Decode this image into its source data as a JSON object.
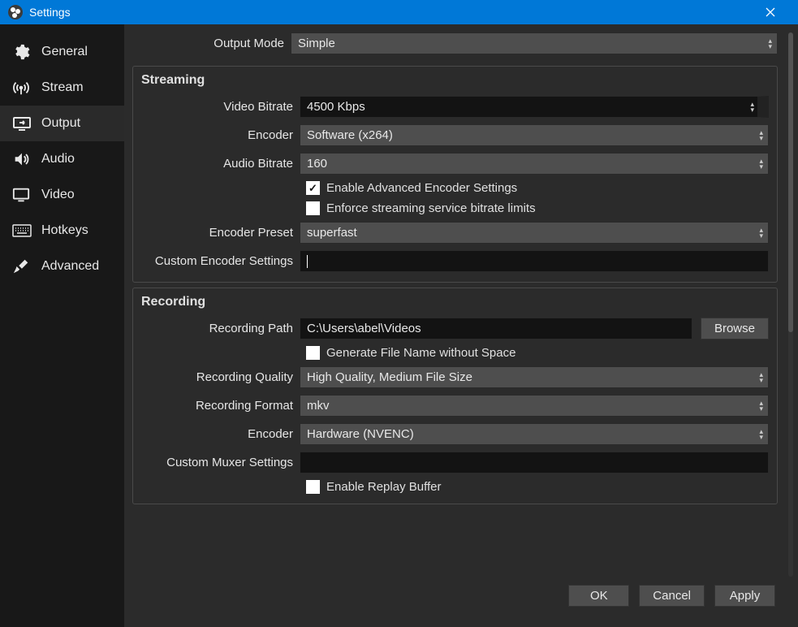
{
  "title": "Settings",
  "sidebar": {
    "items": [
      {
        "label": "General"
      },
      {
        "label": "Stream"
      },
      {
        "label": "Output"
      },
      {
        "label": "Audio"
      },
      {
        "label": "Video"
      },
      {
        "label": "Hotkeys"
      },
      {
        "label": "Advanced"
      }
    ]
  },
  "output_mode": {
    "label": "Output Mode",
    "value": "Simple"
  },
  "streaming": {
    "title": "Streaming",
    "video_bitrate": {
      "label": "Video Bitrate",
      "value": "4500 Kbps"
    },
    "encoder": {
      "label": "Encoder",
      "value": "Software (x264)"
    },
    "audio_bitrate": {
      "label": "Audio Bitrate",
      "value": "160"
    },
    "enable_advanced": {
      "label": "Enable Advanced Encoder Settings",
      "checked": true
    },
    "enforce_limits": {
      "label": "Enforce streaming service bitrate limits",
      "checked": false
    },
    "encoder_preset": {
      "label": "Encoder Preset",
      "value": "superfast"
    },
    "custom_encoder": {
      "label": "Custom Encoder Settings",
      "value": ""
    }
  },
  "recording": {
    "title": "Recording",
    "path": {
      "label": "Recording Path",
      "value": "C:\\Users\\abel\\Videos"
    },
    "browse_label": "Browse",
    "filename_no_space": {
      "label": "Generate File Name without Space",
      "checked": false
    },
    "quality": {
      "label": "Recording Quality",
      "value": "High Quality, Medium File Size"
    },
    "format": {
      "label": "Recording Format",
      "value": "mkv"
    },
    "encoder": {
      "label": "Encoder",
      "value": "Hardware (NVENC)"
    },
    "custom_muxer": {
      "label": "Custom Muxer Settings",
      "value": ""
    },
    "replay_buffer": {
      "label": "Enable Replay Buffer",
      "checked": false
    }
  },
  "buttons": {
    "ok": "OK",
    "cancel": "Cancel",
    "apply": "Apply"
  }
}
